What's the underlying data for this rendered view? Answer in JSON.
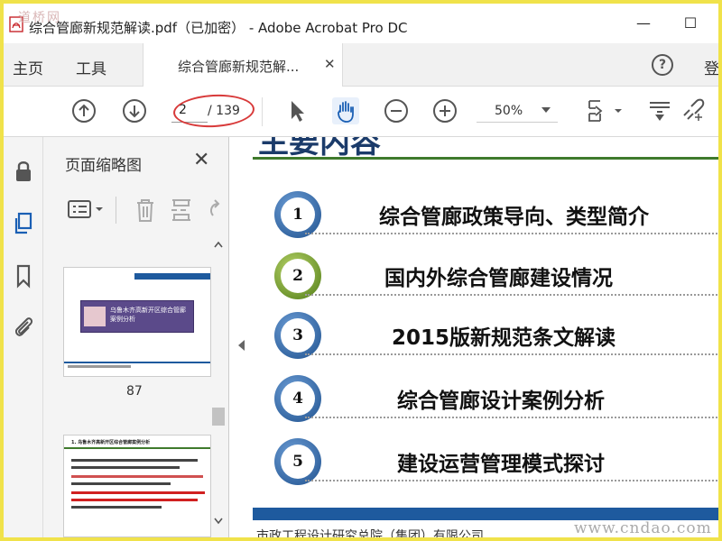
{
  "window": {
    "title": "综合管廊新规范解读.pdf（已加密） - Adobe Acrobat Pro DC",
    "watermark_top": "道桥网",
    "minimize": "—",
    "maximize": "☐"
  },
  "menubar": {
    "home": "主页",
    "tools": "工具",
    "doc_tab": "综合管廊新规范解...",
    "doc_tab_close": "✕",
    "help": "?",
    "login": "登"
  },
  "toolbar": {
    "current_page": "2",
    "total_pages": "/ 139",
    "zoom": "50%"
  },
  "thumbnails": {
    "header": "页面缩略图",
    "close": "✕",
    "page_label_87": "87",
    "thumb87_title": "乌鲁木齐高新开区综合管廊案例分析",
    "thumb88_heading": "1. 乌鲁木齐高新开区综合管廊案例分析"
  },
  "document": {
    "heading": "主要内容",
    "items": [
      {
        "num": "1",
        "text": "综合管廊政策导向、类型简介"
      },
      {
        "num": "2",
        "text": "国内外综合管廊建设情况"
      },
      {
        "num": "3",
        "text": "2015版新规范条文解读"
      },
      {
        "num": "4",
        "text": "综合管廊设计案例分析"
      },
      {
        "num": "5",
        "text": "建设运营管理模式探讨"
      }
    ],
    "footer_org": "市政工程设计研究总院（集团）有限公司",
    "watermark_bottom": "www.cndao.com"
  },
  "colors": {
    "accent_blue": "#1e5a9e",
    "accent_green": "#3f7a2c",
    "annotation_red": "#d83a3a"
  }
}
